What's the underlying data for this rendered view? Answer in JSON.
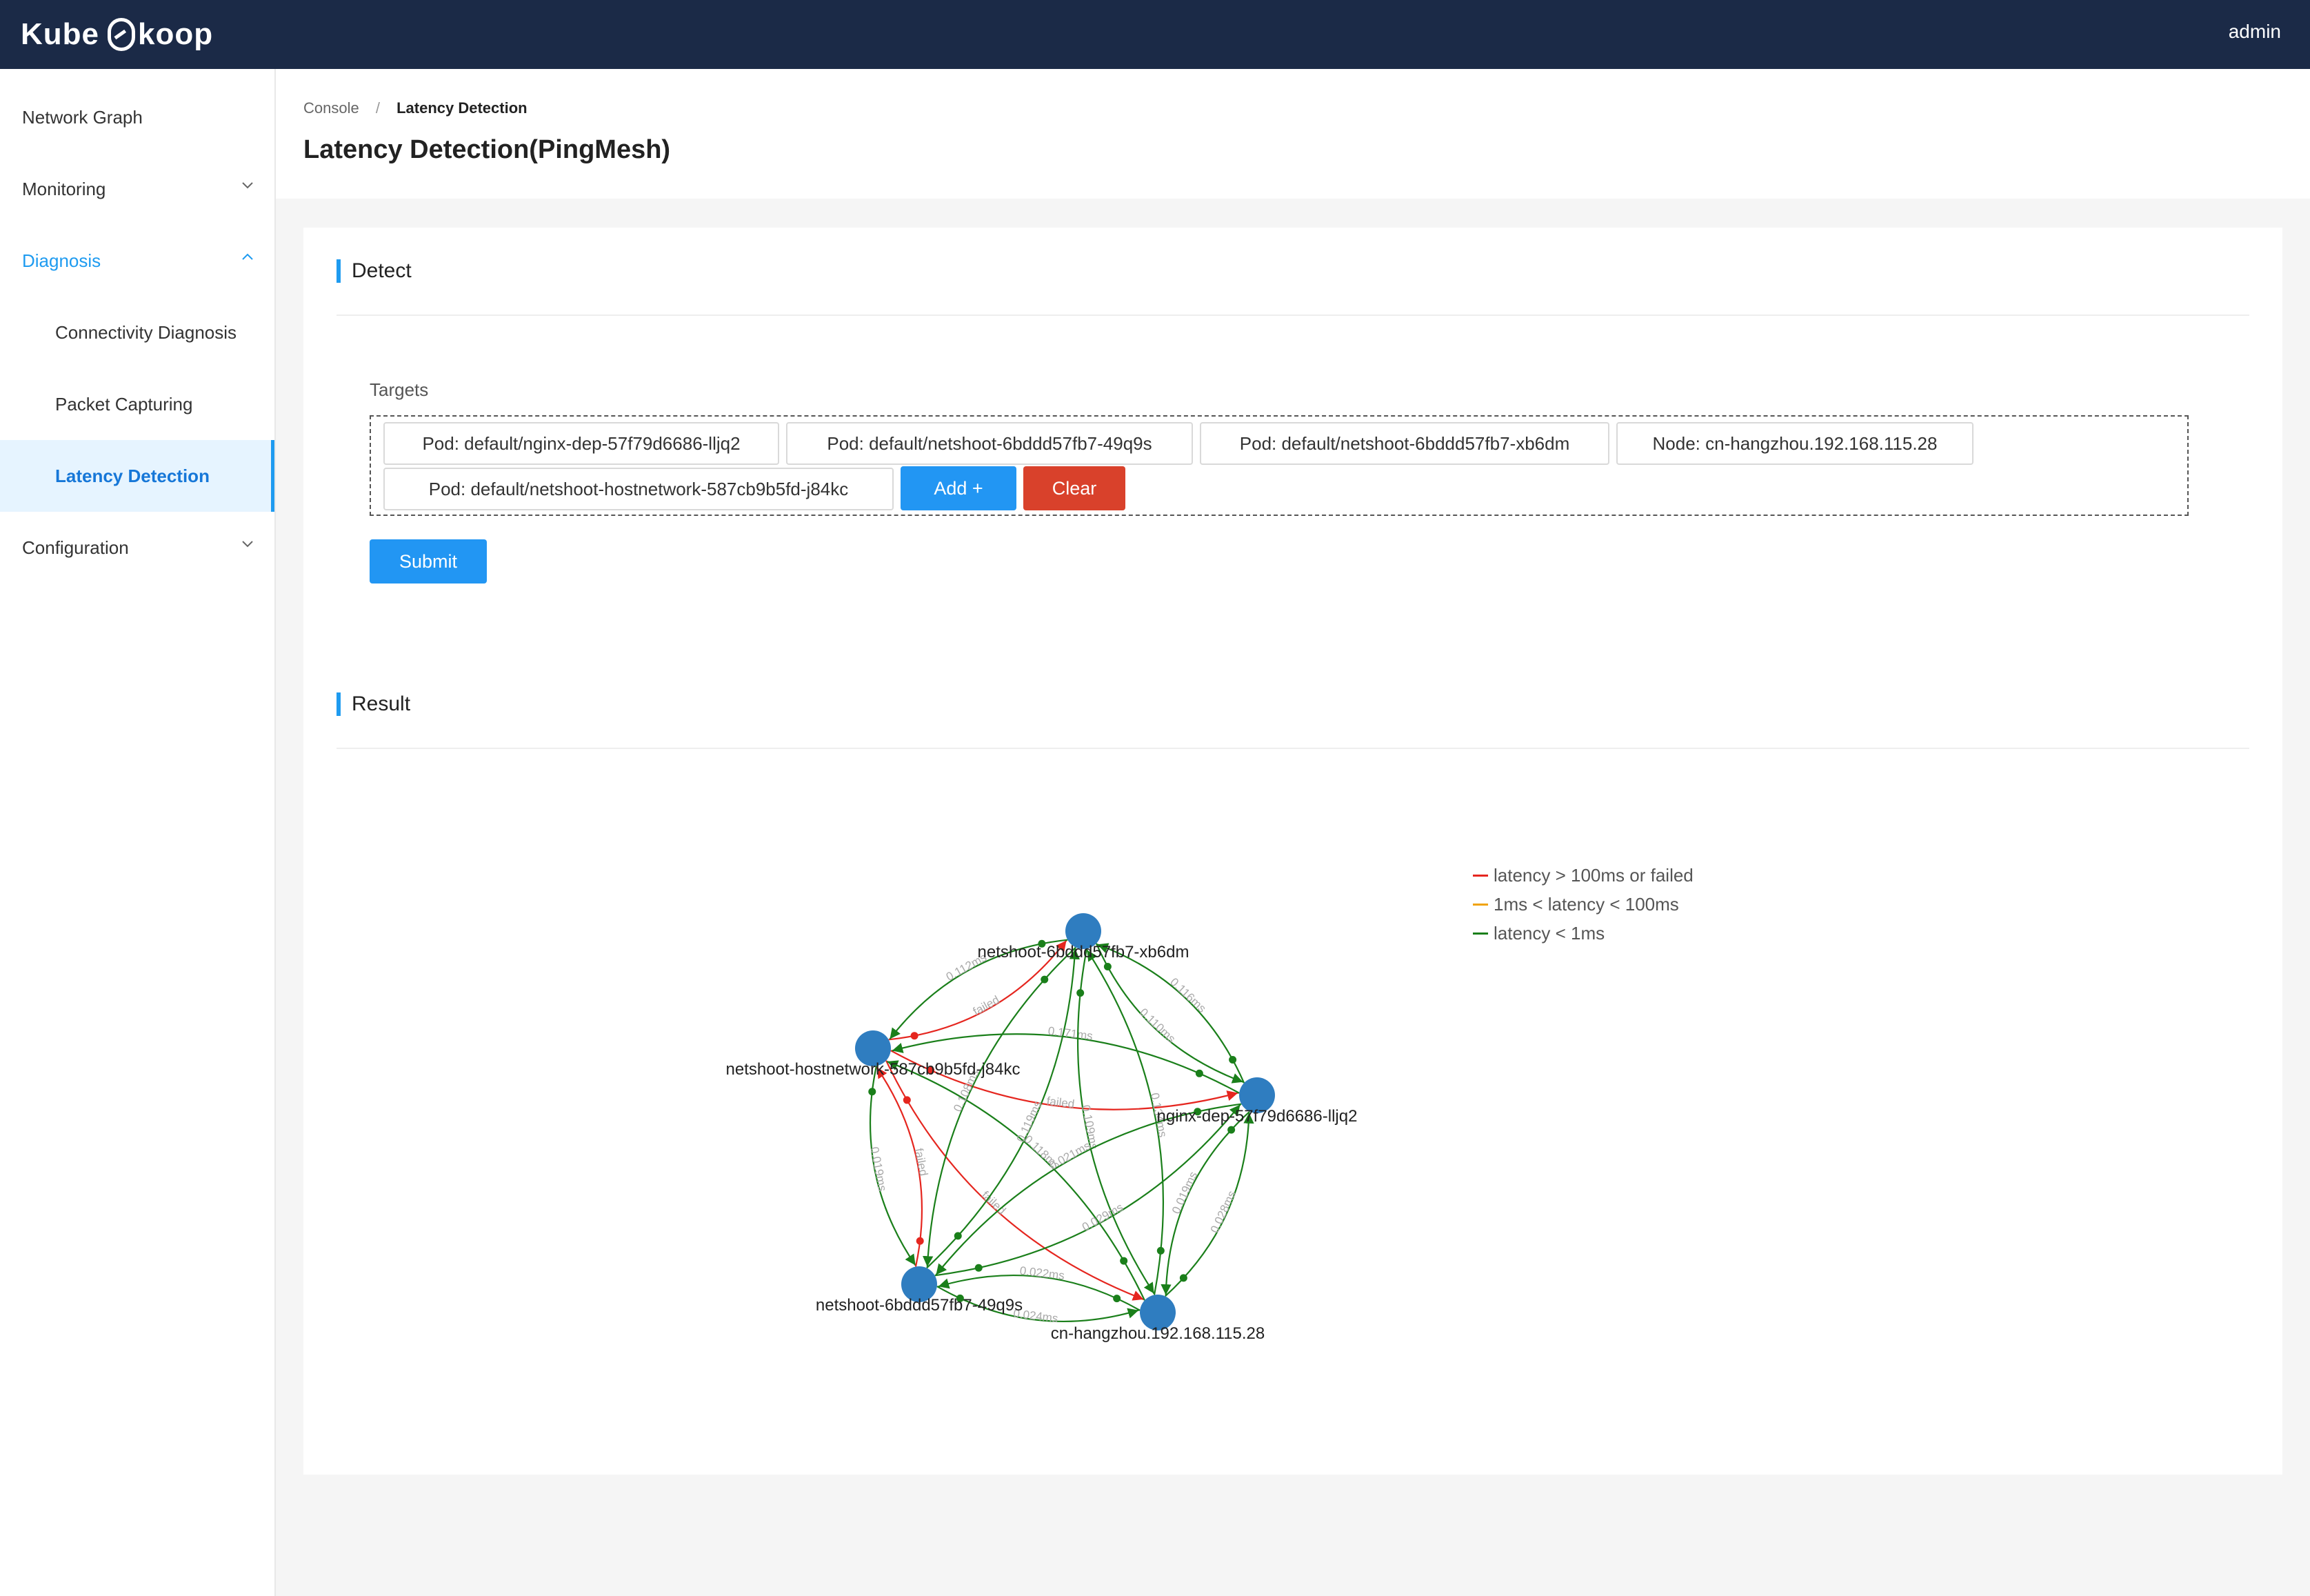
{
  "app": {
    "logo": "Kube",
    "logo_suffix": "koop",
    "user": "admin"
  },
  "sidebar": {
    "items": [
      {
        "label": "Network Graph"
      },
      {
        "label": "Monitoring"
      },
      {
        "label": "Diagnosis"
      },
      {
        "label": "Connectivity Diagnosis"
      },
      {
        "label": "Packet Capturing"
      },
      {
        "label": "Latency Detection"
      },
      {
        "label": "Configuration"
      }
    ]
  },
  "breadcrumb": {
    "root": "Console",
    "separator": "/",
    "current": "Latency Detection"
  },
  "page_title": "Latency Detection(PingMesh)",
  "detect": {
    "title": "Detect",
    "targets_label": "Targets",
    "targets": [
      "Pod: default/nginx-dep-57f79d6686-lljq2",
      "Pod: default/netshoot-6bddd57fb7-49q9s",
      "Pod: default/netshoot-6bddd57fb7-xb6dm",
      "Node: cn-hangzhou.192.168.115.28",
      "Pod: default/netshoot-hostnetwork-587cb9b5fd-j84kc"
    ],
    "add_label": "Add +",
    "clear_label": "Clear",
    "submit_label": "Submit"
  },
  "result": {
    "title": "Result",
    "legend": [
      {
        "label": "latency > 100ms or failed",
        "color": "#e5261f"
      },
      {
        "label": "1ms < latency < 100ms",
        "color": "#f0a30a"
      },
      {
        "label": "latency < 1ms",
        "color": "#1a7f1a"
      }
    ],
    "node_color": "#2f7dc0",
    "nodes": [
      {
        "id": "xb6dm",
        "label": "netshoot-6bddd57fb7-xb6dm"
      },
      {
        "id": "hostnet",
        "label": "netshoot-hostnetwork-587cb9b5fd-j84kc"
      },
      {
        "id": "nginx",
        "label": "nginx-dep-57f79d6686-lljq2"
      },
      {
        "id": "49q9s",
        "label": "netshoot-6bddd57fb7-49q9s"
      },
      {
        "id": "node",
        "label": "cn-hangzhou.192.168.115.28"
      }
    ],
    "edges": [
      {
        "from": "hostnet",
        "to": "xb6dm",
        "status": "failed",
        "label": "failed"
      },
      {
        "from": "xb6dm",
        "to": "hostnet",
        "status": "ok",
        "label": "0.112ms"
      },
      {
        "from": "xb6dm",
        "to": "nginx",
        "status": "ok",
        "label": "0.110ms"
      },
      {
        "from": "nginx",
        "to": "xb6dm",
        "status": "ok",
        "label": "0.116ms"
      },
      {
        "from": "hostnet",
        "to": "nginx",
        "status": "failed",
        "label": "failed"
      },
      {
        "from": "nginx",
        "to": "hostnet",
        "status": "ok",
        "label": "0.171ms"
      },
      {
        "from": "hostnet",
        "to": "49q9s",
        "status": "ok",
        "label": "0.019ms"
      },
      {
        "from": "49q9s",
        "to": "hostnet",
        "status": "failed",
        "label": "failed"
      },
      {
        "from": "hostnet",
        "to": "node",
        "status": "failed",
        "label": "failed"
      },
      {
        "from": "node",
        "to": "hostnet",
        "status": "ok",
        "label": "0.118ms"
      },
      {
        "from": "xb6dm",
        "to": "49q9s",
        "status": "ok",
        "label": "0.108ms"
      },
      {
        "from": "49q9s",
        "to": "xb6dm",
        "status": "ok",
        "label": "0.119ms"
      },
      {
        "from": "xb6dm",
        "to": "node",
        "status": "ok",
        "label": "0.109ms"
      },
      {
        "from": "node",
        "to": "xb6dm",
        "status": "ok",
        "label": "0.134ms"
      },
      {
        "from": "nginx",
        "to": "49q9s",
        "status": "ok",
        "label": "0.021ms"
      },
      {
        "from": "49q9s",
        "to": "nginx",
        "status": "ok",
        "label": "0.029ms"
      },
      {
        "from": "nginx",
        "to": "node",
        "status": "ok",
        "label": "0.019ms"
      },
      {
        "from": "node",
        "to": "nginx",
        "status": "ok",
        "label": "0.028ms"
      },
      {
        "from": "49q9s",
        "to": "node",
        "status": "ok",
        "label": "0.024ms"
      },
      {
        "from": "node",
        "to": "49q9s",
        "status": "ok",
        "label": "0.022ms"
      }
    ]
  }
}
